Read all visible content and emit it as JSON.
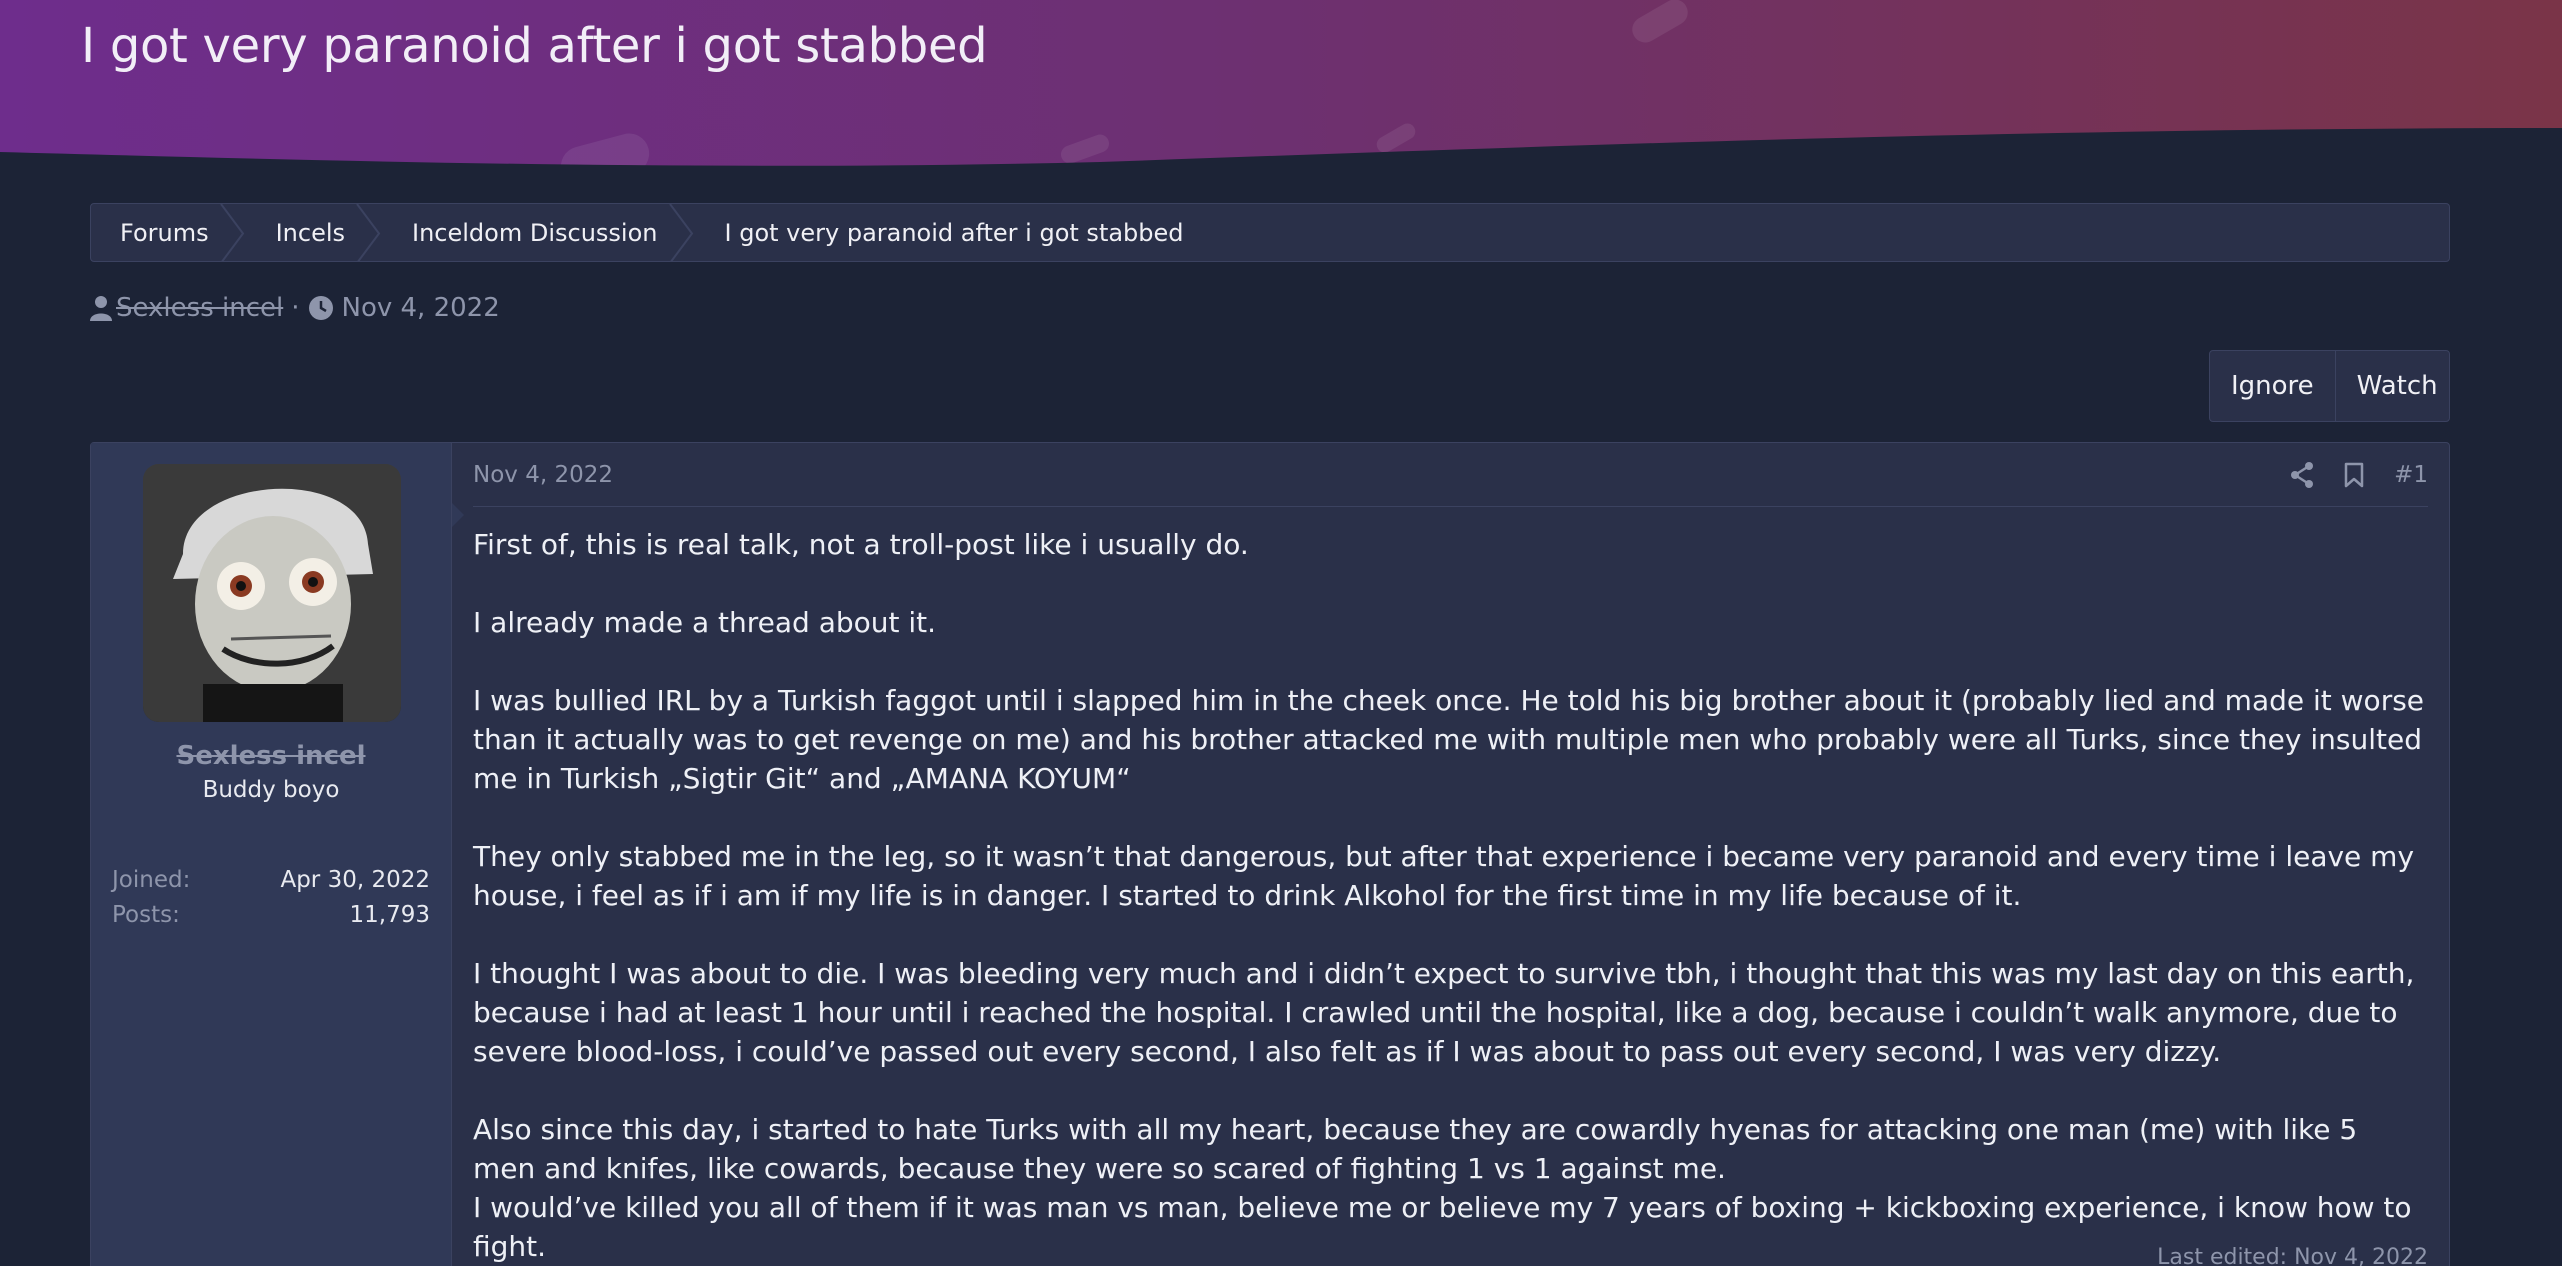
{
  "thread": {
    "title": "I got very paranoid after i got stabbed",
    "author": "Sexless incel",
    "separator": "·",
    "date": "Nov 4, 2022"
  },
  "breadcrumb": [
    {
      "label": "Forums"
    },
    {
      "label": "Incels"
    },
    {
      "label": "Inceldom Discussion"
    },
    {
      "label": "I got very paranoid after i got stabbed"
    }
  ],
  "actions": {
    "ignore": "Ignore",
    "watch": "Watch"
  },
  "post": {
    "user": {
      "name": "Sexless incel",
      "title": "Buddy boyo",
      "joined_label": "Joined:",
      "joined": "Apr 30, 2022",
      "posts_label": "Posts:",
      "posts": "11,793"
    },
    "date": "Nov 4, 2022",
    "number": "#1",
    "paragraphs": [
      "First of, this is real talk, not a troll-post like i usually do.",
      "I already made a thread about it.",
      "I was bullied IRL by a Turkish faggot until i slapped him in the cheek once. He told his big brother about it (probably lied and made it worse than it actually was to get revenge on me) and his brother attacked me with multiple men who probably were all Turks, since they insulted me in Turkish „Sigtir Git“ and „AMANA KOYUM“",
      "They only stabbed me in the leg, so it wasn’t that dangerous, but after that experience i became very paranoid and every time i leave my house, i feel as if i am if my life is in danger. I started to drink Alkohol for the first time in my life because of it.",
      "I thought I was about to die. I was bleeding very much and i didn’t expect to survive tbh, i thought that this was my last day on this earth, because i had at least 1 hour until i reached the hospital. I crawled until the hospital, like a dog, because i couldn’t walk anymore, due to severe blood-loss, i could’ve passed out every second, I also felt as if I was about to pass out every second, I was very dizzy.",
      "Also since this day, i started to hate Turks with all my heart, because they are cowardly hyenas for attacking one man (me) with like 5 men and knifes, like cowards, because they were so scared of fighting 1 vs 1 against me.",
      "I would’ve killed you all of them if it was man vs man, believe me or believe my 7 years of boxing + kickboxing experience, i know how to fight."
    ],
    "last_edited": "Last edited: Nov 4, 2022"
  },
  "icons": {
    "user": "user-icon",
    "clock": "clock-icon",
    "share": "share-icon",
    "bookmark": "bookmark-icon"
  },
  "colors": {
    "background": "#1c2336",
    "panel": "#2a3049",
    "user_panel": "#303957",
    "muted_text": "#8e95ab",
    "banner_start": "#6e2d8c",
    "banner_end": "#7a3448"
  }
}
